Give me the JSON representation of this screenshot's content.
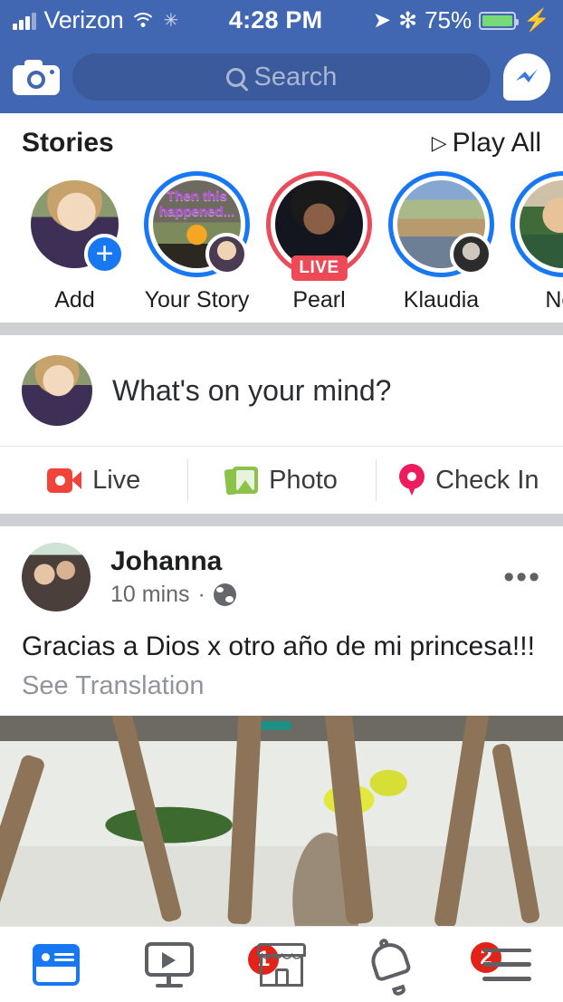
{
  "status_bar": {
    "carrier": "Verizon",
    "time": "4:28 PM",
    "battery_percent": "75%",
    "wifi_icon": "wifi-icon",
    "sync_icon": "sync-icon",
    "location_icon": "location-arrow-icon",
    "bluetooth_icon": "bluetooth-icon",
    "charging_icon": "charging-bolt-icon",
    "battery_fill_color": "#76DB74",
    "background_color": "#4267B2"
  },
  "header": {
    "camera_icon": "camera-icon",
    "search_placeholder": "Search",
    "search_icon": "search-icon",
    "messenger_icon": "messenger-icon",
    "background_color": "#4267B2",
    "pill_color": "#3B5A9B"
  },
  "stories": {
    "title": "Stories",
    "play_all_label": "Play All",
    "play_all_icon": "play-triangle-icon",
    "items": [
      {
        "name": "Add",
        "ring": "none",
        "badge": "plus",
        "overlay_text": ""
      },
      {
        "name": "Your Story",
        "ring": "blue",
        "badge": "mini-avatar",
        "overlay_text": "Then this happened..."
      },
      {
        "name": "Pearl",
        "ring": "red",
        "badge": "live",
        "live_label": "LIVE",
        "overlay_text": ""
      },
      {
        "name": "Klaudia",
        "ring": "blue",
        "badge": "mini-avatar",
        "overlay_text": ""
      },
      {
        "name": "Nor",
        "ring": "blue",
        "badge": "none",
        "overlay_text": ""
      }
    ],
    "ring_blue": "#1877F2",
    "ring_red": "#E94C5A",
    "live_badge_color": "#ED4956"
  },
  "composer": {
    "placeholder": "What's on your mind?",
    "avatar": "user-avatar"
  },
  "composer_actions": [
    {
      "label": "Live",
      "icon": "live-video-icon",
      "color": "#F0433A"
    },
    {
      "label": "Photo",
      "icon": "photo-icon",
      "color": "#8BC34A"
    },
    {
      "label": "Check In",
      "icon": "location-pin-icon",
      "color": "#EC1C5E"
    }
  ],
  "post": {
    "author": "Johanna",
    "timestamp": "10 mins",
    "separator": "·",
    "privacy_icon": "globe-icon",
    "menu_icon": "more-options-icon",
    "text": "Gracias a Dios x otro año de mi princesa!!!",
    "translation_link": "See Translation",
    "image_alt": "garden-photo"
  },
  "bottom_nav": [
    {
      "name": "news-feed",
      "icon": "news-feed-icon",
      "active": true,
      "badge": ""
    },
    {
      "name": "watch",
      "icon": "watch-icon",
      "active": false,
      "badge": "1"
    },
    {
      "name": "marketplace",
      "icon": "marketplace-icon",
      "active": false,
      "badge": ""
    },
    {
      "name": "notifications",
      "icon": "bell-icon",
      "active": false,
      "badge": "2"
    },
    {
      "name": "menu",
      "icon": "hamburger-menu-icon",
      "active": false,
      "badge": ""
    }
  ],
  "colors": {
    "facebook_blue": "#4267B2",
    "accent_blue": "#1877F2",
    "badge_red": "#E2231A",
    "divider_gray": "#CED0D4"
  }
}
